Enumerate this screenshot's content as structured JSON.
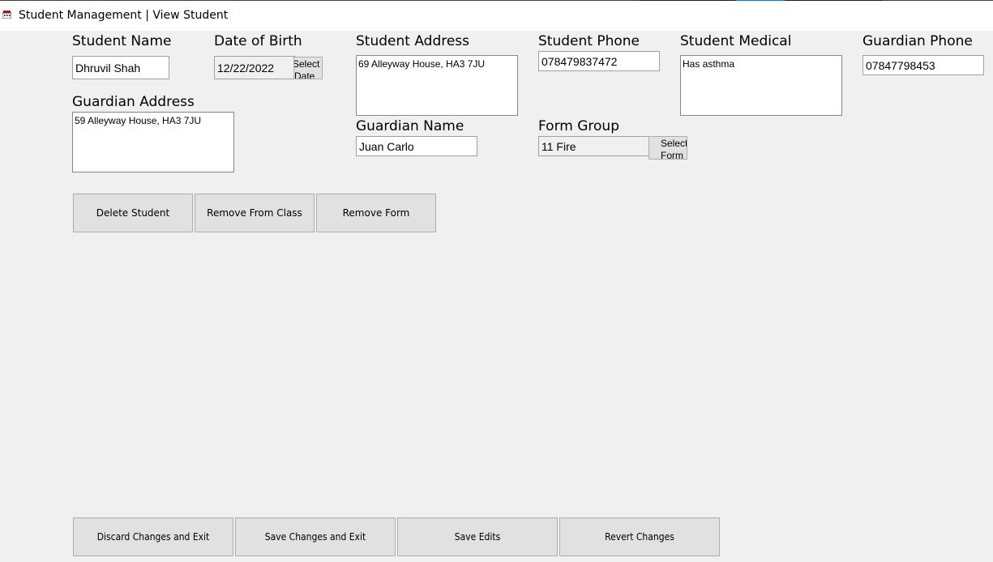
{
  "window": {
    "title": "Student Management | View Student",
    "icon": "school-building-icon"
  },
  "form": {
    "student_name": {
      "label": "Student Name",
      "value": "Dhruvil Shah"
    },
    "date_of_birth": {
      "label": "Date of Birth",
      "value": "12/22/2022",
      "select_button": "Select Date"
    },
    "student_address": {
      "label": "Student Address",
      "value": "69 Alleyway House, HA3 7JU"
    },
    "student_phone": {
      "label": "Student Phone",
      "value": "078479837472"
    },
    "student_medical": {
      "label": "Student Medical",
      "value": "Has asthma"
    },
    "guardian_phone": {
      "label": "Guardian Phone",
      "value": "07847798453"
    },
    "guardian_address": {
      "label": "Guardian Address",
      "value": "59 Alleyway House, HA3 7JU"
    },
    "guardian_name": {
      "label": "Guardian Name",
      "value": "Juan Carlo"
    },
    "form_group": {
      "label": "Form Group",
      "value": "11 Fire",
      "select_button": "Select Form"
    }
  },
  "actions": {
    "delete_student": "Delete Student",
    "remove_from_class": "Remove From Class",
    "remove_form": "Remove Form"
  },
  "footer": {
    "discard_exit": "Discard Changes and Exit",
    "save_exit": "Save Changes and Exit",
    "save_edits": "Save Edits",
    "revert_changes": "Revert Changes"
  },
  "colors": {
    "window_bg": "#f0f0f0",
    "button_bg": "#e1e1e1",
    "button_border": "#adadad",
    "taskbar_accent": "#0078d7"
  }
}
